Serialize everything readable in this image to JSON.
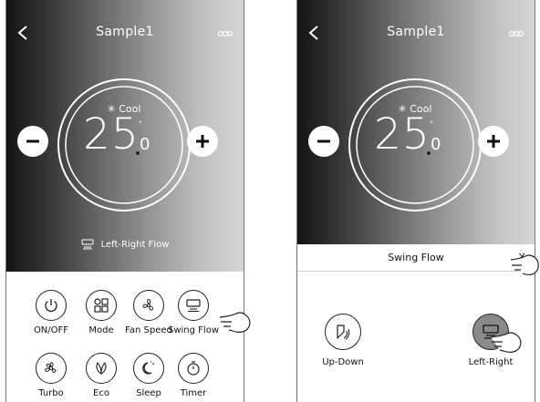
{
  "screens": [
    {
      "title": "Sample1",
      "mode": "Cool",
      "temp_int": "25",
      "temp_dec": "0",
      "temp_unit": "°",
      "flow_status": "Left-Right Flow",
      "functions": [
        {
          "label": "ON/OFF",
          "icon": "power-icon"
        },
        {
          "label": "Mode",
          "icon": "mode-icon"
        },
        {
          "label": "Fan Speed",
          "icon": "fan-speed-icon"
        },
        {
          "label": "Swing Flow",
          "icon": "swing-flow-icon"
        },
        {
          "label": "Turbo",
          "icon": "turbo-icon"
        },
        {
          "label": "Eco",
          "icon": "eco-icon"
        },
        {
          "label": "Sleep",
          "icon": "sleep-icon"
        },
        {
          "label": "Timer",
          "icon": "timer-icon"
        }
      ]
    },
    {
      "title": "Sample1",
      "mode": "Cool",
      "temp_int": "25",
      "temp_dec": "0",
      "temp_unit": "°",
      "swing_panel": {
        "title": "Swing Flow",
        "close": "X",
        "options": [
          {
            "label": "Up-Down",
            "icon": "up-down-icon",
            "selected": false
          },
          {
            "label": "Left-Right",
            "icon": "left-right-icon",
            "selected": true
          }
        ]
      }
    }
  ],
  "colors": {
    "selected_option": "#8a8a8a",
    "hero_dark": "#141414",
    "hero_light": "#d6d6d6"
  }
}
